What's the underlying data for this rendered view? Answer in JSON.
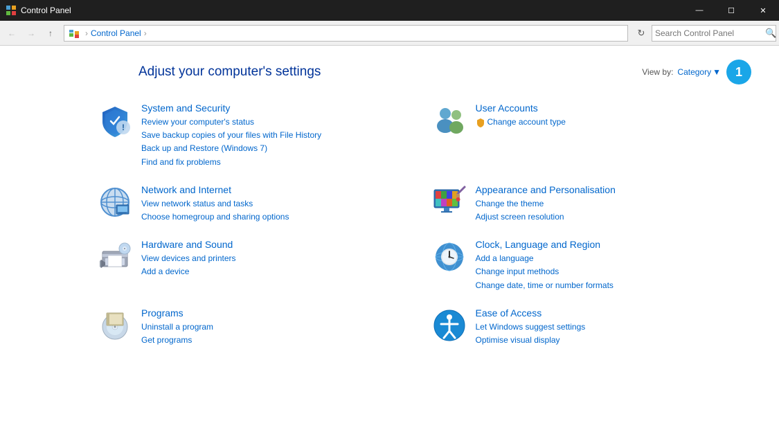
{
  "titlebar": {
    "title": "Control Panel",
    "minimize_label": "—",
    "maximize_label": "☐",
    "close_label": "✕"
  },
  "navbar": {
    "back_title": "Back",
    "forward_title": "Forward",
    "up_title": "Up",
    "breadcrumb": "Control Panel",
    "breadcrumb_arrow": "›",
    "search_placeholder": "Search Control Panel"
  },
  "main": {
    "title": "Adjust your computer's settings",
    "view_by_label": "View by:",
    "view_by_value": "Category",
    "badge_number": "1"
  },
  "categories": [
    {
      "id": "system-security",
      "title": "System and Security",
      "links": [
        "Review your computer's status",
        "Save backup copies of your files with File History",
        "Back up and Restore (Windows 7)",
        "Find and fix problems"
      ]
    },
    {
      "id": "user-accounts",
      "title": "User Accounts",
      "links": [
        "Change account type"
      ],
      "shield_link": true
    },
    {
      "id": "network-internet",
      "title": "Network and Internet",
      "links": [
        "View network status and tasks",
        "Choose homegroup and sharing options"
      ]
    },
    {
      "id": "appearance",
      "title": "Appearance and Personalisation",
      "links": [
        "Change the theme",
        "Adjust screen resolution"
      ]
    },
    {
      "id": "hardware-sound",
      "title": "Hardware and Sound",
      "links": [
        "View devices and printers",
        "Add a device"
      ]
    },
    {
      "id": "clock-language",
      "title": "Clock, Language and Region",
      "links": [
        "Add a language",
        "Change input methods",
        "Change date, time or number formats"
      ]
    },
    {
      "id": "programs",
      "title": "Programs",
      "links": [
        "Uninstall a program",
        "Get programs"
      ]
    },
    {
      "id": "ease-of-access",
      "title": "Ease of Access",
      "links": [
        "Let Windows suggest settings",
        "Optimise visual display"
      ]
    }
  ]
}
